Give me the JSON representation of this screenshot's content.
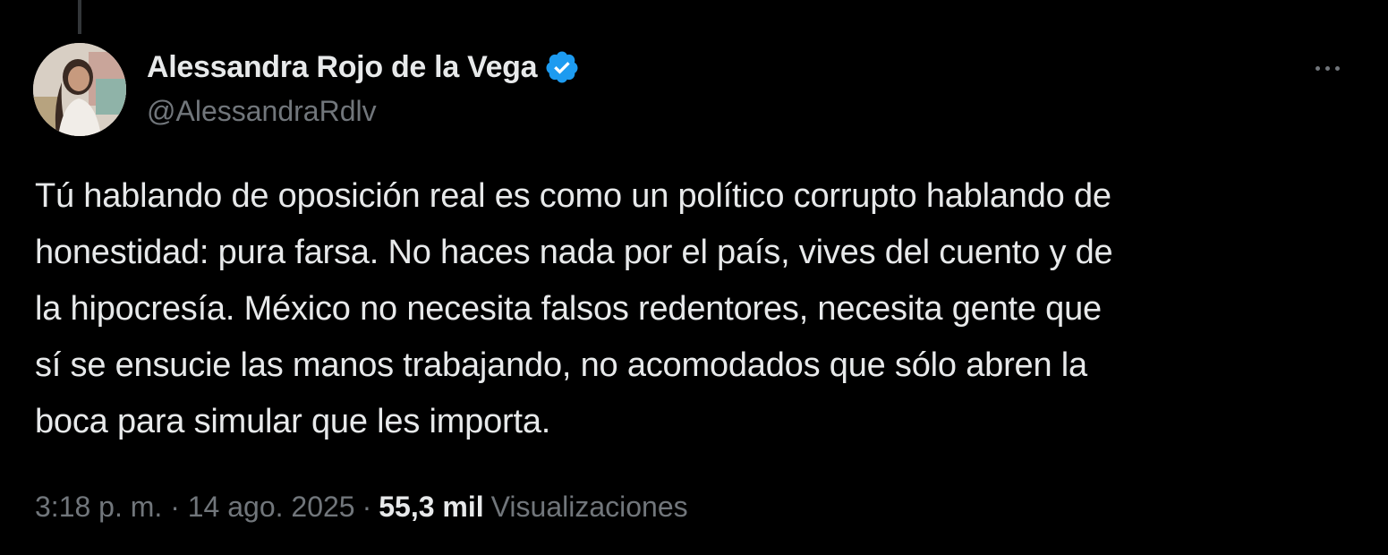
{
  "tweet": {
    "author": {
      "display_name": "Alessandra Rojo de la Vega",
      "handle": "@AlessandraRdlv",
      "verified": true,
      "avatar_icon": "user-avatar"
    },
    "text": "Tú hablando de oposición real es como un político corrupto hablando de\nhonestidad: pura farsa. No haces nada por el país, vives del cuento y de\nla hipocresía. México no necesita falsos redentores, necesita gente que\nsí se ensucie las manos trabajando, no acomodados que sólo abren la\nboca para simular que les importa.",
    "timestamp": "3:18 p. m. · 14 ago. 2025",
    "separator": "·",
    "views_count": "55,3 mil",
    "views_label": "Visualizaciones"
  },
  "icons": {
    "more": "more-options-icon",
    "verified": "verified-badge-icon"
  },
  "colors": {
    "background": "#000000",
    "primary_text": "#e7e9ea",
    "secondary_text": "#71767b",
    "verified_blue": "#1d9bf0"
  }
}
